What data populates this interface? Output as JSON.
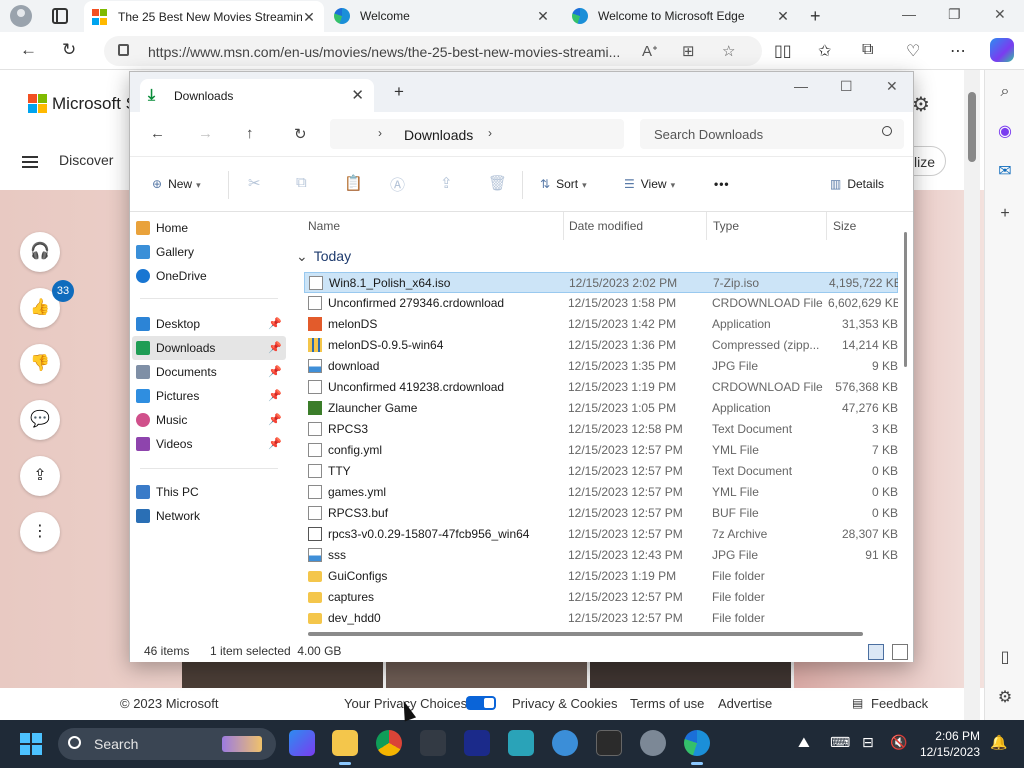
{
  "browser": {
    "tabs": [
      {
        "title": "The 25 Best New Movies Streaming",
        "active": true,
        "favicon": "microsoft-icon"
      },
      {
        "title": "Welcome",
        "active": false,
        "favicon": "edge-icon"
      },
      {
        "title": "Welcome to Microsoft Edge",
        "active": false,
        "favicon": "edge-icon"
      }
    ],
    "url": "https://www.msn.com/en-us/movies/news/the-25-best-new-movies-streami...",
    "new_tab": "+",
    "window_controls": {
      "minimize": "—",
      "maximize": "❐",
      "close": "✕"
    }
  },
  "msn": {
    "brand": "Microsoft S",
    "discover": "Discover",
    "pill_text": "lize",
    "like_count": "33",
    "footer": {
      "copyright": "© 2023 Microsoft",
      "privacy_choices": "Your Privacy Choices",
      "privacy_cookies": "Privacy & Cookies",
      "terms": "Terms of use",
      "advertise": "Advertise",
      "feedback": "Feedback"
    }
  },
  "explorer": {
    "tab_title": "Downloads",
    "breadcrumb": "Downloads",
    "search_placeholder": "Search Downloads",
    "commands": {
      "new": "New",
      "sort": "Sort",
      "view": "View",
      "more": "•••",
      "details": "Details"
    },
    "nav": {
      "home": "Home",
      "gallery": "Gallery",
      "onedrive": "OneDrive",
      "desktop": "Desktop",
      "downloads": "Downloads",
      "documents": "Documents",
      "pictures": "Pictures",
      "music": "Music",
      "videos": "Videos",
      "this_pc": "This PC",
      "network": "Network"
    },
    "columns": {
      "name": "Name",
      "date": "Date modified",
      "type": "Type",
      "size": "Size"
    },
    "group": "Today",
    "files": [
      {
        "name": "Win8.1_Polish_x64.iso",
        "date": "12/15/2023 2:02 PM",
        "type": "7-Zip.iso",
        "size": "4,195,722 KB",
        "icon": "file",
        "selected": true
      },
      {
        "name": "Unconfirmed 279346.crdownload",
        "date": "12/15/2023 1:58 PM",
        "type": "CRDOWNLOAD File",
        "size": "6,602,629 KB",
        "icon": "file"
      },
      {
        "name": "melonDS",
        "date": "12/15/2023 1:42 PM",
        "type": "Application",
        "size": "31,353 KB",
        "icon": "app"
      },
      {
        "name": "melonDS-0.9.5-win64",
        "date": "12/15/2023 1:36 PM",
        "type": "Compressed (zipp...",
        "size": "14,214 KB",
        "icon": "zip"
      },
      {
        "name": "download",
        "date": "12/15/2023 1:35 PM",
        "type": "JPG File",
        "size": "9 KB",
        "icon": "jpg"
      },
      {
        "name": "Unconfirmed 419238.crdownload",
        "date": "12/15/2023 1:19 PM",
        "type": "CRDOWNLOAD File",
        "size": "576,368 KB",
        "icon": "file"
      },
      {
        "name": "Zlauncher Game",
        "date": "12/15/2023 1:05 PM",
        "type": "Application",
        "size": "47,276 KB",
        "icon": "zl"
      },
      {
        "name": "RPCS3",
        "date": "12/15/2023 12:58 PM",
        "type": "Text Document",
        "size": "3 KB",
        "icon": "file"
      },
      {
        "name": "config.yml",
        "date": "12/15/2023 12:57 PM",
        "type": "YML File",
        "size": "7 KB",
        "icon": "file"
      },
      {
        "name": "TTY",
        "date": "12/15/2023 12:57 PM",
        "type": "Text Document",
        "size": "0 KB",
        "icon": "file"
      },
      {
        "name": "games.yml",
        "date": "12/15/2023 12:57 PM",
        "type": "YML File",
        "size": "0 KB",
        "icon": "file"
      },
      {
        "name": "RPCS3.buf",
        "date": "12/15/2023 12:57 PM",
        "type": "BUF File",
        "size": "0 KB",
        "icon": "file"
      },
      {
        "name": "rpcs3-v0.0.29-15807-47fcb956_win64",
        "date": "12/15/2023 12:57 PM",
        "type": "7z Archive",
        "size": "28,307 KB",
        "icon": "arc"
      },
      {
        "name": "sss",
        "date": "12/15/2023 12:43 PM",
        "type": "JPG File",
        "size": "91 KB",
        "icon": "jpg"
      },
      {
        "name": "GuiConfigs",
        "date": "12/15/2023 1:19 PM",
        "type": "File folder",
        "size": "",
        "icon": "folder"
      },
      {
        "name": "captures",
        "date": "12/15/2023 12:57 PM",
        "type": "File folder",
        "size": "",
        "icon": "folder"
      },
      {
        "name": "dev_hdd0",
        "date": "12/15/2023 12:57 PM",
        "type": "File folder",
        "size": "",
        "icon": "folder"
      }
    ],
    "status": {
      "items": "46 items",
      "selected": "1 item selected  4.00 GB"
    }
  },
  "taskbar": {
    "search_label": "Search",
    "time": "2:06 PM",
    "date": "12/15/2023"
  },
  "colors": {
    "accent": "#0f6cbd",
    "selection": "#cce4f7",
    "taskbar": "#1f2a37"
  }
}
